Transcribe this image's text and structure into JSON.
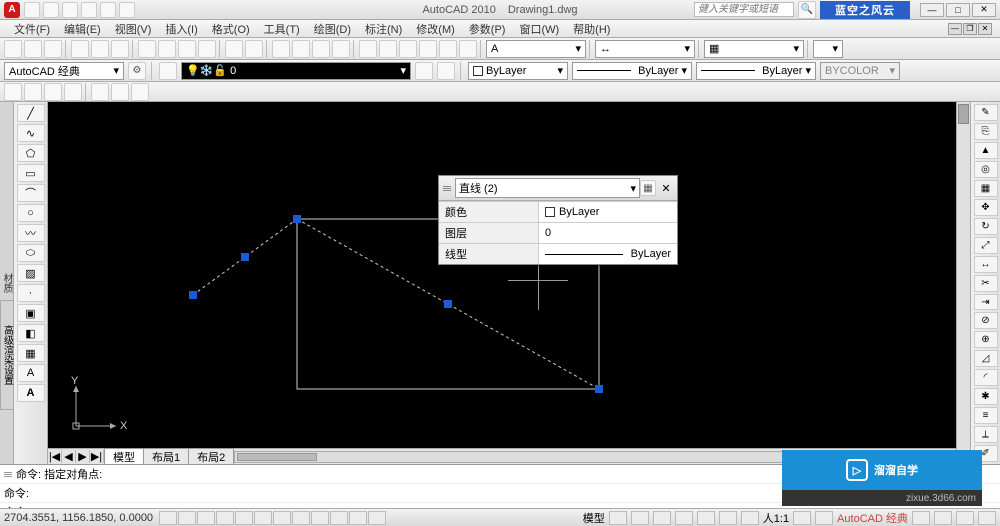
{
  "app": {
    "name": "AutoCAD 2010",
    "document": "Drawing1.dwg",
    "help_placeholder": "健入关键字或短语",
    "brand_label": "蓝空之风云"
  },
  "menus": [
    "文件(F)",
    "编辑(E)",
    "视图(V)",
    "插入(I)",
    "格式(O)",
    "工具(T)",
    "绘图(D)",
    "标注(N)",
    "修改(M)",
    "参数(P)",
    "窗口(W)",
    "帮助(H)"
  ],
  "workspace": {
    "current": "AutoCAD 经典"
  },
  "layer_panel": {
    "layer_combo": "0",
    "color_combo": "ByLayer",
    "lineweight_combo": "ByLayer",
    "linetype_combo": "ByLayer",
    "plotstyle": "BYCOLOR"
  },
  "palettes": {
    "left1": "材质",
    "left2": "高级渲染设置"
  },
  "right_tool_names": [
    "move-icon",
    "rotate-icon",
    "trim-icon",
    "shell-icon",
    "pan-icon",
    "zoom-icon",
    "orbit-icon",
    "home-icon",
    "layer-icon",
    "prop-icon",
    "sweep-icon",
    "mirror-icon",
    "extend-icon",
    "offset-icon",
    "array-icon",
    "scale-icon",
    "stretch-icon",
    "fillet-icon",
    "chamfer-icon",
    "explode-icon",
    "join-icon"
  ],
  "left_tool_names": [
    "line-icon",
    "polyline-icon",
    "circle-icon",
    "arc-icon",
    "rectangle-icon",
    "ellipse-icon",
    "hatch-icon",
    "text-icon",
    "mtext-icon",
    "table-icon",
    "point-icon",
    "region-icon",
    "spline-icon",
    "donut-icon",
    "block-icon",
    "A-text-icon"
  ],
  "quick_properties": {
    "title": "直线 (2)",
    "rows": [
      {
        "label": "颜色",
        "value": "ByLayer"
      },
      {
        "label": "图层",
        "value": "0"
      },
      {
        "label": "线型",
        "value": "ByLayer"
      }
    ]
  },
  "ucs": {
    "x_label": "X",
    "y_label": "Y"
  },
  "model_tabs": {
    "nav": [
      "|◀",
      "◀",
      "▶",
      "▶|"
    ],
    "tabs": [
      "模型",
      "布局1",
      "布局2"
    ]
  },
  "command": {
    "lines": [
      "命令: 指定对角点:",
      "命令:",
      "命令:"
    ]
  },
  "status": {
    "coords": "2704.3551, 1156.1850, 0.0000",
    "model_label": "模型",
    "scale": "人1:1",
    "workspace": "AutoCAD 经典"
  },
  "watermark": {
    "main": "溜溜自学",
    "url": "zixue.3d66.com"
  }
}
